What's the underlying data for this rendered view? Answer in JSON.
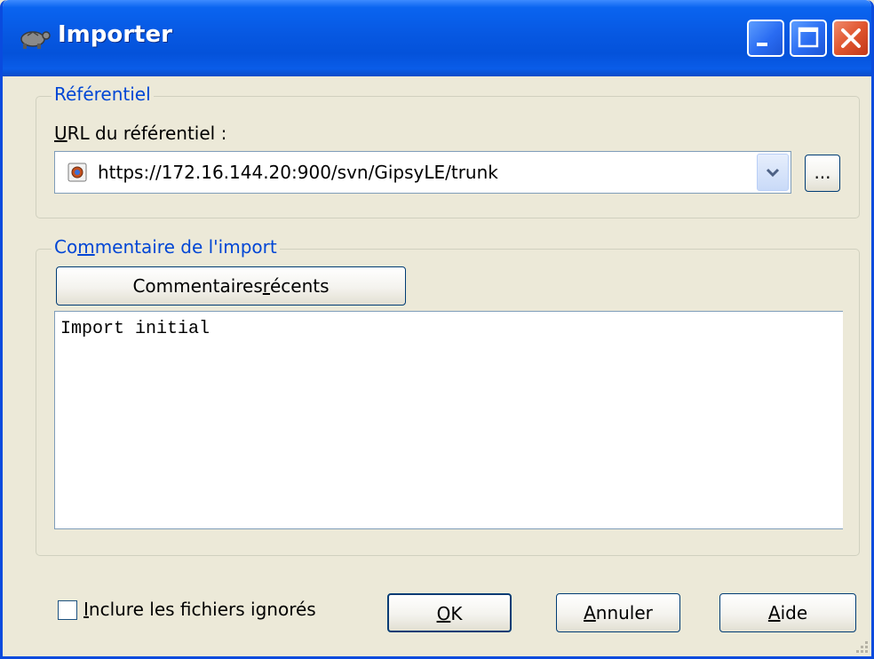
{
  "window": {
    "title": "Importer"
  },
  "repository": {
    "group_label": "Référentiel",
    "url_label_accel": "U",
    "url_label_rest": "RL du référentiel :",
    "url_value": "https://172.16.144.20:900/svn/GipsyLE/trunk",
    "browse_label": "..."
  },
  "import_comment": {
    "group_label_pre": "Co",
    "group_label_accel": "m",
    "group_label_post": "mentaire de l'import",
    "recent_pre": "Commentaires ",
    "recent_accel": "r",
    "recent_post": "écents",
    "text": "Import initial"
  },
  "footer": {
    "include_ignored_accel": "I",
    "include_ignored_rest": "nclure les fichiers ignorés",
    "include_ignored_checked": false,
    "ok_accel": "O",
    "ok_rest": "K",
    "cancel_accel": "A",
    "cancel_rest": "nnuler",
    "help_accel": "A",
    "help_rest": "ide"
  },
  "colors": {
    "titlebar": "#0758E2",
    "group_label": "#0046D5",
    "dialog_bg": "#ECE9D8"
  }
}
